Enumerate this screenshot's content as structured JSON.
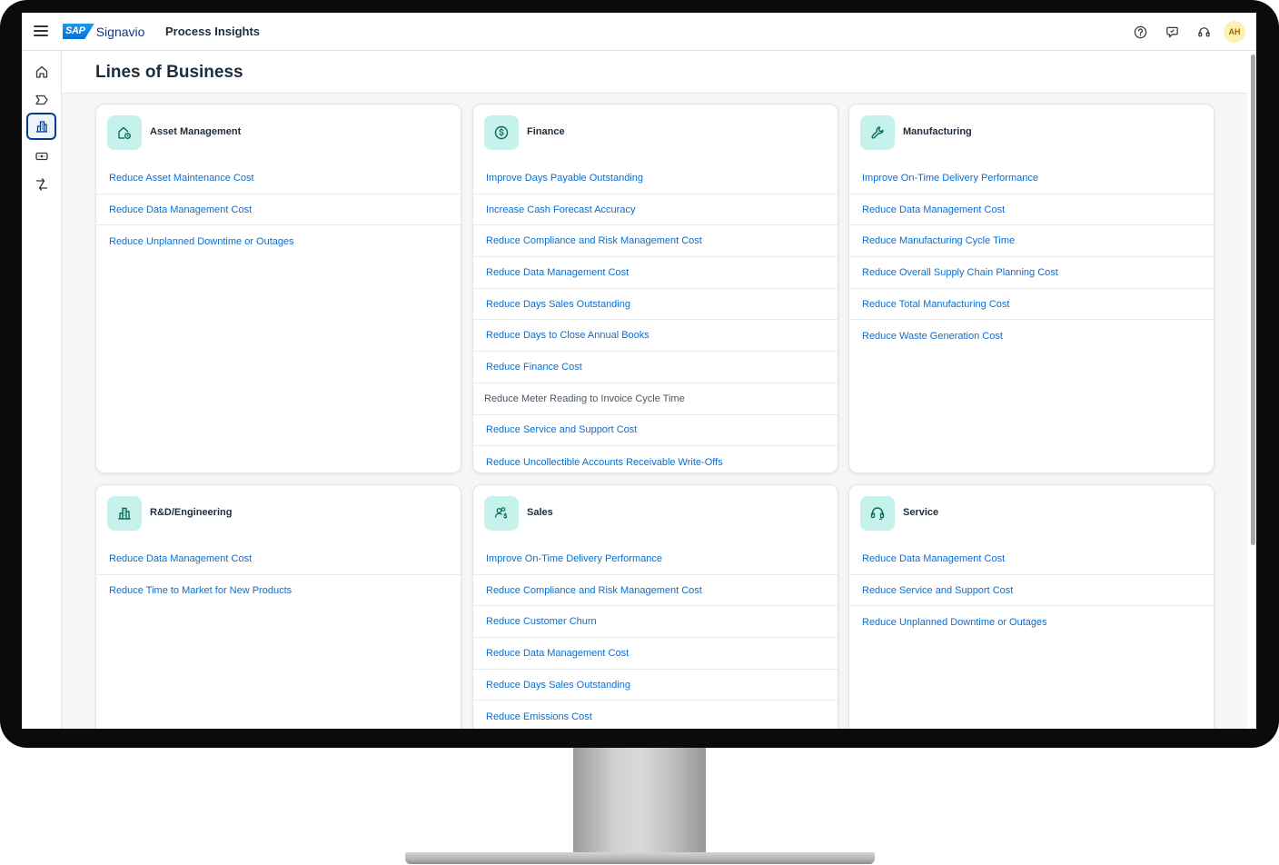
{
  "shell": {
    "brand_sap": "SAP",
    "brand_name": "Signavio",
    "app_title": "Process Insights",
    "avatar_initials": "AH"
  },
  "page": {
    "title": "Lines of Business"
  },
  "cards": [
    {
      "title": "Asset Management",
      "icon": "asset-management-icon",
      "items": [
        "Reduce Asset Maintenance Cost",
        "Reduce Data Management Cost",
        "Reduce Unplanned Downtime or Outages"
      ]
    },
    {
      "title": "Finance",
      "icon": "finance-dollar-icon",
      "items": [
        "Improve Days Payable Outstanding",
        "Increase Cash Forecast Accuracy",
        "Reduce Compliance and Risk Management Cost",
        "Reduce Data Management Cost",
        "Reduce Days Sales Outstanding",
        "Reduce Days to Close Annual Books",
        "Reduce Finance Cost",
        "Reduce Meter Reading to Invoice Cycle Time",
        "Reduce Service and Support Cost",
        "Reduce Uncollectible Accounts Receivable Write-Offs"
      ]
    },
    {
      "title": "Manufacturing",
      "icon": "wrench-icon",
      "items": [
        "Improve On-Time Delivery Performance",
        "Reduce Data Management Cost",
        "Reduce Manufacturing Cycle Time",
        "Reduce Overall Supply Chain Planning Cost",
        "Reduce Total Manufacturing Cost",
        "Reduce Waste Generation Cost"
      ]
    },
    {
      "title": "R&D/Engineering",
      "icon": "building-icon",
      "items": [
        "Reduce Data Management Cost",
        "Reduce Time to Market for New Products"
      ]
    },
    {
      "title": "Sales",
      "icon": "sales-people-icon",
      "items": [
        "Improve On-Time Delivery Performance",
        "Reduce Compliance and Risk Management Cost",
        "Reduce Customer Churn",
        "Reduce Data Management Cost",
        "Reduce Days Sales Outstanding",
        "Reduce Emissions Cost"
      ]
    },
    {
      "title": "Service",
      "icon": "headset-icon",
      "items": [
        "Reduce Data Management Cost",
        "Reduce Service and Support Cost",
        "Reduce Unplanned Downtime or Outages"
      ]
    }
  ],
  "colors": {
    "link": "#0a6ed1",
    "icon_bg": "#c6f2ec",
    "icon_fg": "#0b6b62",
    "title": "#1d2d3e"
  }
}
